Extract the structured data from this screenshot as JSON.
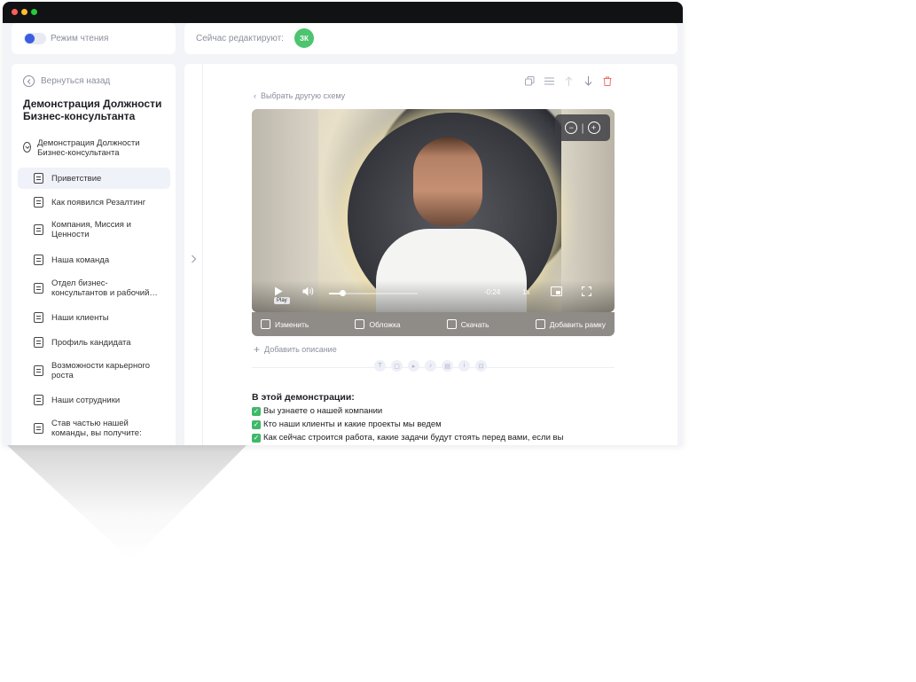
{
  "top_bar": {
    "reading_mode_label": "Режим чтения",
    "editing_label": "Сейчас редактируют:",
    "editor_initials": "ЗК"
  },
  "sidebar": {
    "back_label": "Вернуться назад",
    "title": "Демонстрация Должности Бизнес-консультанта",
    "section_label": "Демонстрация Должности Бизнес-консультанта",
    "items": [
      {
        "label": "Приветствие"
      },
      {
        "label": "Как появился Резалтинг"
      },
      {
        "label": "Компания, Миссия и Ценности"
      },
      {
        "label": "Наша команда"
      },
      {
        "label": "Отдел бизнес-консультантов и рабочий…"
      },
      {
        "label": "Наши клиенты"
      },
      {
        "label": "Профиль кандидата"
      },
      {
        "label": "Возможности карьерного роста"
      },
      {
        "label": "Наши сотрудники"
      },
      {
        "label": "Став частью нашей команды, вы получите:"
      }
    ]
  },
  "main": {
    "choose_scheme_label": "Выбрать другую схему",
    "video": {
      "time_remaining": "-0:24",
      "speed": "1x",
      "play_tooltip": "Play",
      "progress_fraction": 0.15
    },
    "video_actions": {
      "edit": "Изменить",
      "cover": "Обложка",
      "download": "Скачать",
      "add_frame": "Добавить рамку"
    },
    "add_description_label": "Добавить описание",
    "content": {
      "heading": "В этой демонстрации:",
      "bullets": [
        "Вы узнаете о нашей компании",
        "Кто наши клиенты и какие проекты мы ведем",
        "Как сейчас строится работа, какие задачи  будут  стоять перед вами, если вы"
      ]
    }
  },
  "colors": {
    "accent": "#3b5ee0",
    "avatar": "#4dc46f",
    "check": "#3fb86a",
    "delete_icon": "#e8736b"
  }
}
